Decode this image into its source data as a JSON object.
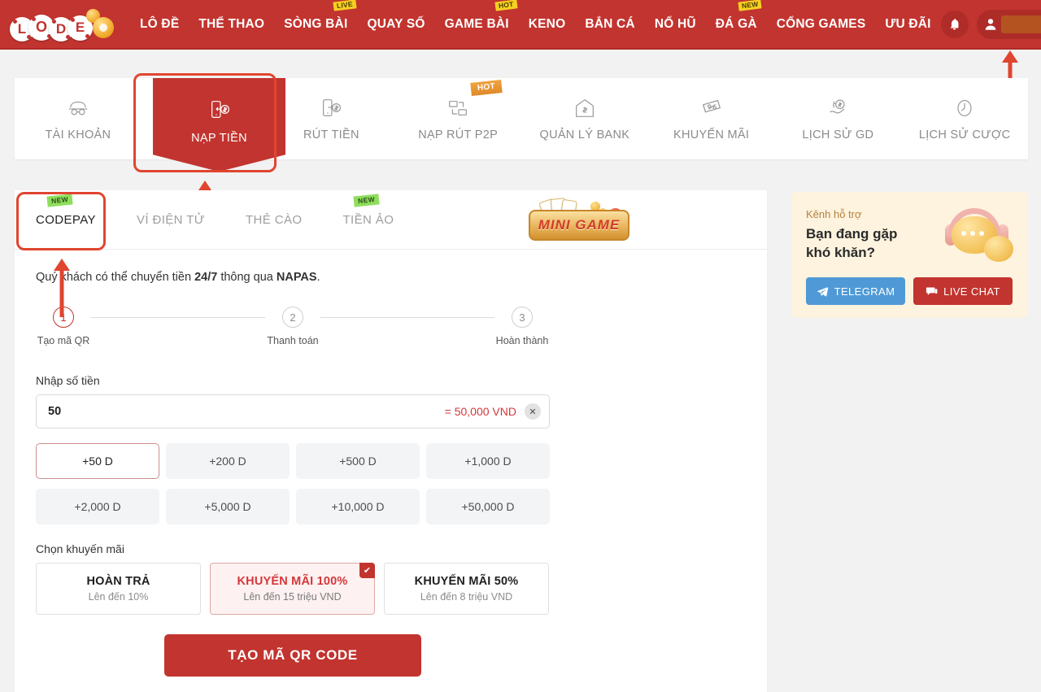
{
  "header": {
    "logo_text": "LODE",
    "logo_letters": [
      "L",
      "O",
      "D",
      "E"
    ],
    "nav": [
      {
        "label": "LÔ ĐỀ",
        "badge": null
      },
      {
        "label": "THỂ THAO",
        "badge": null
      },
      {
        "label": "SÒNG BÀI",
        "badge": "LIVE"
      },
      {
        "label": "QUAY SỐ",
        "badge": null
      },
      {
        "label": "GAME BÀI",
        "badge": "HOT"
      },
      {
        "label": "KENO",
        "badge": null
      },
      {
        "label": "BẮN CÁ",
        "badge": null
      },
      {
        "label": "NỔ HŨ",
        "badge": null
      },
      {
        "label": "ĐÁ GÀ",
        "badge": "NEW"
      },
      {
        "label": "CỔNG GAMES",
        "badge": null
      },
      {
        "label": "ƯU ĐÃI",
        "badge": null
      }
    ],
    "bell_icon": "bell-icon",
    "user_icon": "user-avatar-icon",
    "balance_value": "",
    "deposit_plus_label": "+",
    "bg_color": "#c2342f"
  },
  "tabs": [
    {
      "label": "TÀI KHOẢN",
      "icon": "account-mask-icon",
      "badge": null,
      "active": false
    },
    {
      "label": "NẠP TIỀN",
      "icon": "deposit-phone-dollar-icon",
      "badge": null,
      "active": true
    },
    {
      "label": "RÚT TIỀN",
      "icon": "withdraw-phone-dollar-icon",
      "badge": null,
      "active": false
    },
    {
      "label": "NẠP RÚT P2P",
      "icon": "p2p-network-icon",
      "badge": "HOT",
      "active": false
    },
    {
      "label": "QUẢN LÝ BANK",
      "icon": "bank-house-icon",
      "badge": null,
      "active": false
    },
    {
      "label": "KHUYẾN MÃI",
      "icon": "promo-ticket-icon",
      "badge": null,
      "active": false
    },
    {
      "label": "LỊCH SỬ GD",
      "icon": "transaction-history-icon",
      "badge": null,
      "active": false
    },
    {
      "label": "LỊCH SỬ CƯỢC",
      "icon": "bet-history-clock-icon",
      "badge": null,
      "active": false
    }
  ],
  "subtabs": [
    {
      "label": "CODEPAY",
      "badge": "NEW",
      "active": true
    },
    {
      "label": "VÍ ĐIỆN TỬ",
      "badge": null,
      "active": false
    },
    {
      "label": "THẺ CÀO",
      "badge": null,
      "active": false
    },
    {
      "label": "TIỀN ẢO",
      "badge": "NEW",
      "active": false
    }
  ],
  "minigame": {
    "label": "MINI GAME"
  },
  "panel": {
    "intro_pre": "Quý khách có thể chuyển tiền ",
    "intro_bold1": "24/7",
    "intro_mid": " thông qua ",
    "intro_bold2": "NAPAS",
    "intro_post": ".",
    "steps": [
      {
        "num": "1",
        "label": "Tạo mã QR",
        "active": true
      },
      {
        "num": "2",
        "label": "Thanh toán",
        "active": false
      },
      {
        "num": "3",
        "label": "Hoàn thành",
        "active": false
      }
    ],
    "amount_label": "Nhập số tiền",
    "amount_value": "50",
    "amount_placeholder": "Nhập số tiền",
    "amount_equivalent": "= 50,000 VND",
    "clear_icon": "clear-x-icon",
    "quick_amounts": [
      {
        "label": "+50 D",
        "selected": true
      },
      {
        "label": "+200 D",
        "selected": false
      },
      {
        "label": "+500 D",
        "selected": false
      },
      {
        "label": "+1,000 D",
        "selected": false
      },
      {
        "label": "+2,000 D",
        "selected": false
      },
      {
        "label": "+5,000 D",
        "selected": false
      },
      {
        "label": "+10,000 D",
        "selected": false
      },
      {
        "label": "+50,000 D",
        "selected": false
      }
    ],
    "promo_label": "Chọn khuyến mãi",
    "promos": [
      {
        "title": "HOÀN TRẢ",
        "sub": "Lên đến 10%",
        "selected": false
      },
      {
        "title": "KHUYẾN MÃI 100%",
        "sub": "Lên đến 15 triệu VND",
        "selected": true
      },
      {
        "title": "KHUYẾN MÃI 50%",
        "sub": "Lên đến 8 triệu VND",
        "selected": false
      }
    ],
    "cta_label": "TẠO MÃ QR CODE"
  },
  "support": {
    "kicker": "Kênh hỗ trợ",
    "title_line1": "Bạn đang gặp",
    "title_line2": "khó khăn?",
    "telegram_label": "TELEGRAM",
    "livechat_label": "LIVE CHAT",
    "telegram_color": "#4f9ad6",
    "livechat_color": "#c2342f",
    "bg_color": "#fdf3de"
  },
  "annotations": {
    "highlight_color": "#e0452f",
    "arrows": [
      "arrow-to-plus-button",
      "arrow-to-nap-tien-tab",
      "arrow-to-codepay-tab"
    ]
  }
}
